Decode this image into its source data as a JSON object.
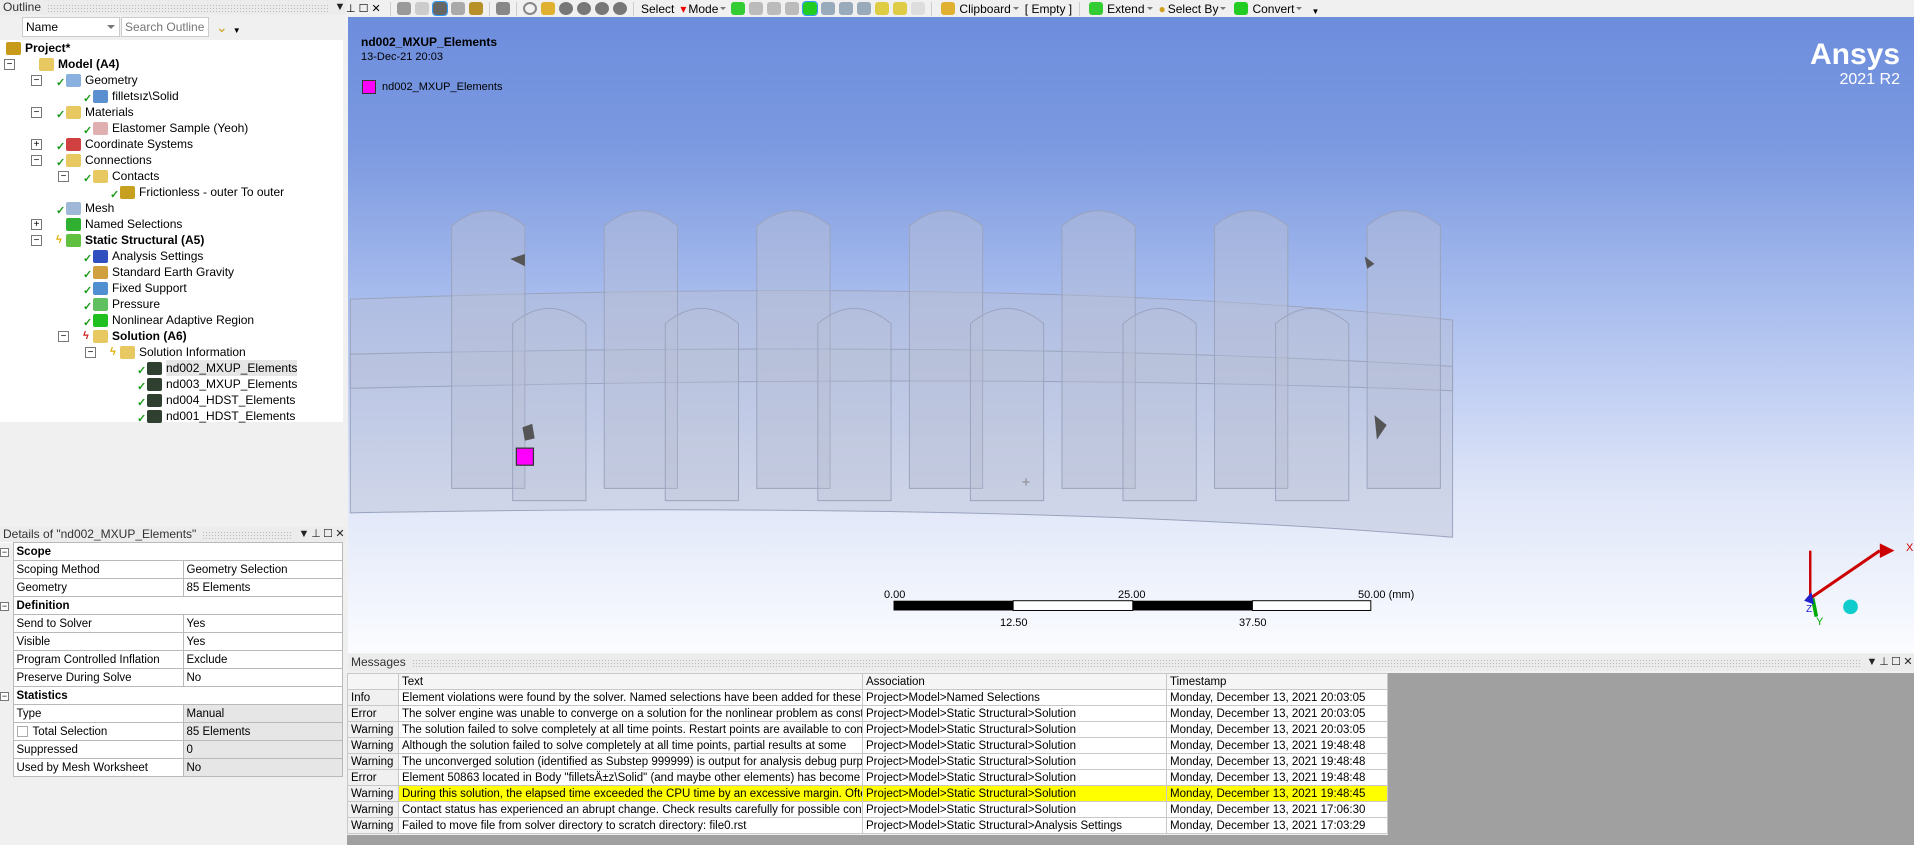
{
  "outline": {
    "title": "Outline",
    "filter_value": "Name",
    "search_placeholder": "Search Outline",
    "items": [
      {
        "label": "Project*",
        "level": 0,
        "bold": true,
        "exp": "",
        "status": "",
        "icon": "project-icon",
        "color": "#c89a1a"
      },
      {
        "label": "Model (A4)",
        "level": 1,
        "bold": true,
        "exp": "-",
        "status": "",
        "icon": "model-icon",
        "color": "#e8c860"
      },
      {
        "label": "Geometry",
        "level": 2,
        "exp": "-",
        "status": "check",
        "icon": "geometry-icon",
        "color": "#8ab0e0"
      },
      {
        "label": "filletsız\\Solid",
        "level": 3,
        "exp": "",
        "status": "check",
        "icon": "solid-icon",
        "color": "#5a90d0"
      },
      {
        "label": "Materials",
        "level": 2,
        "exp": "-",
        "status": "check",
        "icon": "materials-icon",
        "color": "#e8c860"
      },
      {
        "label": "Elastomer Sample (Yeoh)",
        "level": 3,
        "exp": "",
        "status": "check",
        "icon": "material-tag-icon",
        "color": "#e0b0b0"
      },
      {
        "label": "Coordinate Systems",
        "level": 2,
        "exp": "+",
        "status": "check",
        "icon": "coordinate-systems-icon",
        "color": "#d04040"
      },
      {
        "label": "Connections",
        "level": 2,
        "exp": "-",
        "status": "check",
        "icon": "connections-icon",
        "color": "#e8c860"
      },
      {
        "label": "Contacts",
        "level": 3,
        "exp": "-",
        "status": "check",
        "icon": "contacts-icon",
        "color": "#e8c860"
      },
      {
        "label": "Frictionless - outer To outer",
        "level": 4,
        "exp": "",
        "status": "check",
        "icon": "contact-region-icon",
        "color": "#c8a020"
      },
      {
        "label": "Mesh",
        "level": 2,
        "exp": "",
        "status": "check",
        "icon": "mesh-icon",
        "color": "#a0b8d8"
      },
      {
        "label": "Named Selections",
        "level": 2,
        "exp": "+",
        "status": "",
        "icon": "named-selections-icon",
        "color": "#30b030"
      },
      {
        "label": "Static Structural (A5)",
        "level": 2,
        "bold": true,
        "exp": "-",
        "status": "bolt",
        "icon": "static-structural-icon",
        "color": "#60c040"
      },
      {
        "label": "Analysis Settings",
        "level": 3,
        "exp": "",
        "status": "check",
        "icon": "analysis-settings-icon",
        "color": "#3050c0"
      },
      {
        "label": "Standard Earth Gravity",
        "level": 3,
        "exp": "",
        "status": "check",
        "icon": "gravity-icon",
        "color": "#d0a040"
      },
      {
        "label": "Fixed Support",
        "level": 3,
        "exp": "",
        "status": "check",
        "icon": "fixed-support-icon",
        "color": "#5090d0"
      },
      {
        "label": "Pressure",
        "level": 3,
        "exp": "",
        "status": "check",
        "icon": "pressure-icon",
        "color": "#60c060"
      },
      {
        "label": "Nonlinear Adaptive Region",
        "level": 3,
        "exp": "",
        "status": "check",
        "icon": "nonlinear-adaptive-icon",
        "color": "#20c020"
      },
      {
        "label": "Solution (A6)",
        "level": 3,
        "bold": true,
        "exp": "-",
        "status": "bolt-red",
        "icon": "solution-icon",
        "color": "#e8c860"
      },
      {
        "label": "Solution Information",
        "level": 4,
        "exp": "-",
        "status": "bolt",
        "icon": "solution-information-icon",
        "color": "#e8c860"
      },
      {
        "label": "nd002_MXUP_Elements",
        "level": 5,
        "exp": "",
        "status": "check",
        "selected": true,
        "icon": "element-selection-icon",
        "color": "#304030"
      },
      {
        "label": "nd003_MXUP_Elements",
        "level": 5,
        "exp": "",
        "status": "check",
        "icon": "element-selection-icon",
        "color": "#304030"
      },
      {
        "label": "nd004_HDST_Elements",
        "level": 5,
        "exp": "",
        "status": "check",
        "icon": "element-selection-icon",
        "color": "#304030"
      },
      {
        "label": "nd001_HDST_Elements",
        "level": 5,
        "exp": "",
        "status": "check",
        "icon": "element-selection-icon",
        "color": "#304030"
      }
    ]
  },
  "details": {
    "title": "Details of \"nd002_MXUP_Elements\"",
    "rows": [
      {
        "section": "Scope"
      },
      {
        "k": "Scoping Method",
        "v": "Geometry Selection"
      },
      {
        "k": "Geometry",
        "v": "85 Elements"
      },
      {
        "section": "Definition"
      },
      {
        "k": "Send to Solver",
        "v": "Yes"
      },
      {
        "k": "Visible",
        "v": "Yes"
      },
      {
        "k": "Program Controlled Inflation",
        "v": "Exclude"
      },
      {
        "k": "Preserve During Solve",
        "v": "No"
      },
      {
        "section": "Statistics"
      },
      {
        "k": "Type",
        "v": "Manual",
        "ro": true
      },
      {
        "k": "Total Selection",
        "v": "85 Elements",
        "ro": true,
        "checkbox": true
      },
      {
        "k": "Suppressed",
        "v": "0",
        "ro": true
      },
      {
        "k": "Used by Mesh Worksheet",
        "v": "No",
        "ro": true
      }
    ]
  },
  "toolbar": {
    "select": "Select",
    "mode": "Mode",
    "clipboard": "Clipboard",
    "empty": "[ Empty ]",
    "extend": "Extend",
    "select_by": "Select By",
    "convert": "Convert"
  },
  "viewport": {
    "title": "nd002_MXUP_Elements",
    "date": "13-Dec-21 20:03",
    "legend": "nd002_MXUP_Elements",
    "legend_color": "#ff00ff",
    "brand": "Ansys",
    "version": "2021 R2",
    "scale": {
      "t0": "0.00",
      "t25": "25.00",
      "t50": "50.00 (mm)",
      "t12": "12.50",
      "t37": "37.50"
    },
    "triad": {
      "x": "X",
      "y": "Y",
      "z": "Z"
    }
  },
  "messages": {
    "title": "Messages",
    "columns": [
      "",
      "Text",
      "Association",
      "Timestamp"
    ],
    "rows": [
      {
        "type": "Info",
        "text": "Element violations were found by the solver.  Named selections have been added for these",
        "assoc": "Project>Model>Named Selections",
        "time": "Monday, December 13, 2021 20:03:05"
      },
      {
        "type": "Error",
        "text": "The solver engine was unable to converge on a solution for the nonlinear problem as constrained",
        "assoc": "Project>Model>Static Structural>Solution",
        "time": "Monday, December 13, 2021 20:03:05"
      },
      {
        "type": "Warning",
        "text": "The solution failed to solve completely at all time points. Restart points are available to continue",
        "assoc": "Project>Model>Static Structural>Solution",
        "time": "Monday, December 13, 2021 20:03:05"
      },
      {
        "type": "Warning",
        "text": "Although the solution failed to solve completely at all time points, partial results at some",
        "assoc": "Project>Model>Static Structural>Solution",
        "time": "Monday, December 13, 2021 19:48:48"
      },
      {
        "type": "Warning",
        "text": "The unconverged solution (identified as Substep 999999) is output for analysis debug purposes",
        "assoc": "Project>Model>Static Structural>Solution",
        "time": "Monday, December 13, 2021 19:48:48"
      },
      {
        "type": "Error",
        "text": "Element 50863 located in Body \"filletsÄ±z\\Solid\" (and maybe other elements) has become",
        "assoc": "Project>Model>Static Structural>Solution",
        "time": "Monday, December 13, 2021 19:48:48"
      },
      {
        "type": "Warning",
        "text": "During this solution, the elapsed time exceeded the CPU time by an excessive margin.  Often",
        "assoc": "Project>Model>Static Structural>Solution",
        "time": "Monday, December 13, 2021 19:48:45",
        "highlight": true
      },
      {
        "type": "Warning",
        "text": "Contact status has experienced an abrupt change.  Check results carefully for possible contact",
        "assoc": "Project>Model>Static Structural>Solution",
        "time": "Monday, December 13, 2021 17:06:30"
      },
      {
        "type": "Warning",
        "text": "Failed to move file from solver directory to scratch directory: file0.rst",
        "assoc": "Project>Model>Static Structural>Analysis Settings",
        "time": "Monday, December 13, 2021 17:03:29"
      }
    ]
  },
  "colors": {
    "highlight": "#ffff00",
    "viewport_top": "#6d8ddd",
    "check": "#1a9a1a"
  }
}
